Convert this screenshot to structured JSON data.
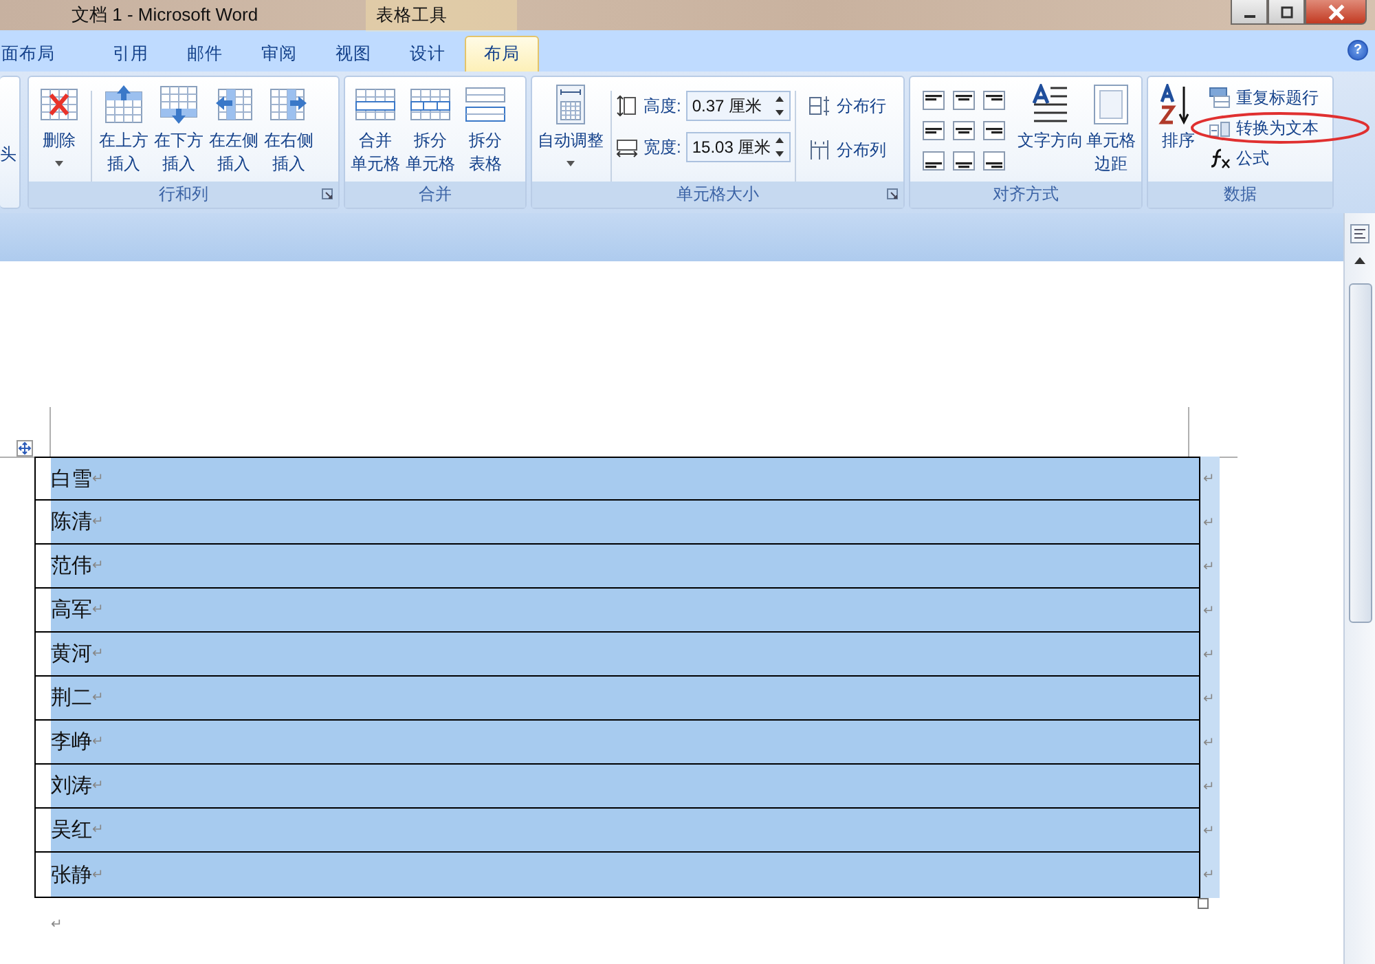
{
  "window": {
    "title": "文档 1 - Microsoft Word",
    "context_group": "表格工具",
    "help": "?"
  },
  "tabs": [
    {
      "label": "面布局",
      "selected": false
    },
    {
      "label": "引用",
      "selected": false
    },
    {
      "label": "邮件",
      "selected": false
    },
    {
      "label": "审阅",
      "selected": false
    },
    {
      "label": "视图",
      "selected": false
    },
    {
      "label": "设计",
      "selected": false
    },
    {
      "label": "布局",
      "selected": true
    }
  ],
  "ribbon": {
    "groups": [
      {
        "items": [
          {
            "kind": "cut",
            "text": "头"
          }
        ]
      },
      {
        "label": "行和列",
        "launcher": true,
        "items": [
          {
            "kind": "large",
            "lines": [
              "删除"
            ],
            "dropdown": true,
            "divider_after": true
          },
          {
            "kind": "large",
            "lines": [
              "在上方",
              "插入"
            ]
          },
          {
            "kind": "large",
            "lines": [
              "在下方",
              "插入"
            ]
          },
          {
            "kind": "large",
            "lines": [
              "在左侧",
              "插入"
            ]
          },
          {
            "kind": "large",
            "lines": [
              "在右侧",
              "插入"
            ]
          }
        ]
      },
      {
        "label": "合并",
        "items": [
          {
            "kind": "large",
            "lines": [
              "合并",
              "单元格"
            ]
          },
          {
            "kind": "large",
            "lines": [
              "拆分",
              "单元格"
            ]
          },
          {
            "kind": "large",
            "lines": [
              "拆分",
              "表格"
            ]
          }
        ]
      },
      {
        "label": "单元格大小",
        "launcher": true,
        "items": [
          {
            "kind": "large",
            "lines": [
              "自动调整"
            ],
            "dropdown": true,
            "divider_after": true
          },
          {
            "kind": "fields",
            "fields": [
              {
                "label": "高度:",
                "value": "0.37 厘米"
              },
              {
                "label": "宽度:",
                "value": "15.03 厘米"
              }
            ],
            "divider_after": true
          },
          {
            "kind": "small",
            "buttons": [
              {
                "label": "分布行"
              },
              {
                "label": "分布列"
              }
            ]
          }
        ]
      },
      {
        "label": "对齐方式",
        "items": [
          {
            "kind": "align_grid"
          },
          {
            "kind": "large",
            "lines": [
              "文字方向"
            ]
          },
          {
            "kind": "large",
            "lines": [
              "单元格",
              "边距"
            ]
          }
        ]
      },
      {
        "label": "数据",
        "items": [
          {
            "kind": "large",
            "lines": [
              "排序"
            ]
          },
          {
            "kind": "small",
            "buttons": [
              {
                "label": "重复标题行"
              },
              {
                "label": "转换为文本",
                "highlighted": true
              },
              {
                "label": "公式"
              }
            ]
          }
        ]
      }
    ]
  },
  "table": {
    "rows": [
      {
        "text": "白雪",
        "mark": "↵",
        "end_mark": "↵",
        "selected": true
      },
      {
        "text": "陈清",
        "mark": "↵",
        "end_mark": "↵",
        "selected": true
      },
      {
        "text": "范伟",
        "mark": "↵",
        "end_mark": "↵",
        "selected": true
      },
      {
        "text": "高军",
        "mark": "↵",
        "end_mark": "↵",
        "selected": true
      },
      {
        "text": "黄河",
        "mark": "↵",
        "end_mark": "↵",
        "selected": true
      },
      {
        "text": "荆二",
        "mark": "↵",
        "end_mark": "↵",
        "selected": true
      },
      {
        "text": "李峥",
        "mark": "↵",
        "end_mark": "↵",
        "selected": true
      },
      {
        "text": "刘涛",
        "mark": "↵",
        "end_mark": "↵",
        "selected": true
      },
      {
        "text": "吴红",
        "mark": "↵",
        "end_mark": "↵",
        "selected": true
      },
      {
        "text": "张静",
        "mark": "↵",
        "end_mark": "↵",
        "selected": true
      }
    ]
  },
  "after_table_mark": "↵"
}
